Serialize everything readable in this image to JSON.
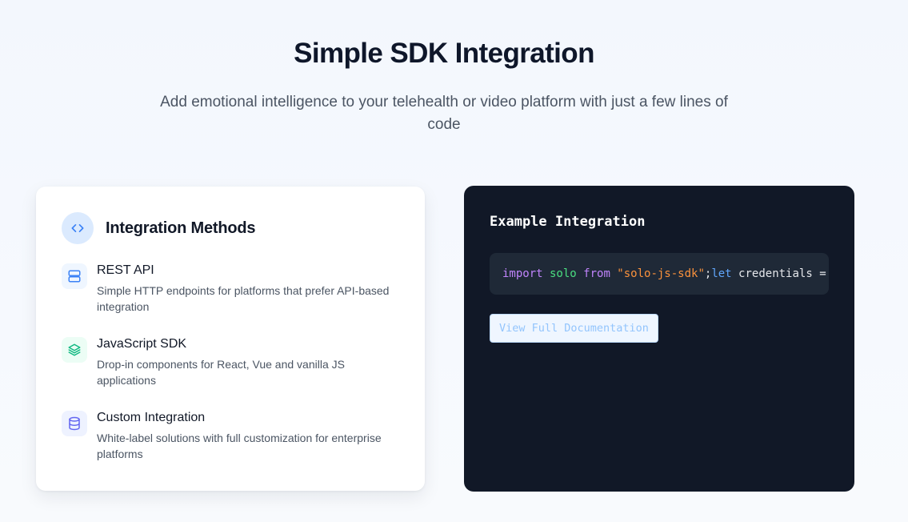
{
  "page": {
    "title": "Simple SDK Integration",
    "subtitle": "Add emotional intelligence to your telehealth or video platform with just a few lines of code"
  },
  "methods_card": {
    "title": "Integration Methods",
    "header_icon": "code-brackets-icon",
    "items": [
      {
        "name": "REST API",
        "description": "Simple HTTP endpoints for platforms that prefer API-based integration",
        "icon": "server-icon",
        "icon_color": "#3b82f6",
        "icon_bg": "#eff6ff"
      },
      {
        "name": "JavaScript SDK",
        "description": "Drop-in components for React, Vue and vanilla JS applications",
        "icon": "layers-icon",
        "icon_color": "#10b981",
        "icon_bg": "#ecfdf5"
      },
      {
        "name": "Custom Integration",
        "description": "White-label solutions with full customization for enterprise platforms",
        "icon": "database-icon",
        "icon_color": "#6366f1",
        "icon_bg": "#eef2ff"
      }
    ]
  },
  "code_card": {
    "title": "Example Integration",
    "code_tokens": {
      "kw_import": "import",
      "ident_solo": " solo ",
      "kw_from": "from",
      "str_sdk": " \"solo-js-sdk\"",
      "semi": ";",
      "kw_let": "let",
      "rest": " credentials = "
    },
    "button_label": "View Full Documentation"
  },
  "colors": {
    "code_background": "#111827",
    "code_box": "#1f2937",
    "accent_blue": "#3b82f6"
  }
}
